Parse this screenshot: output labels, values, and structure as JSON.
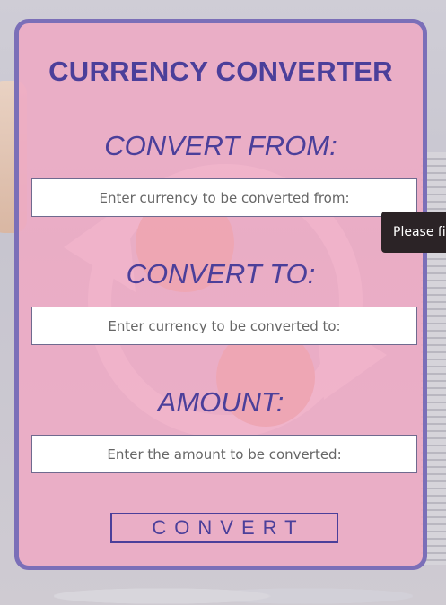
{
  "title": "CURRENCY CONVERTER",
  "from": {
    "label": "CONVERT FROM:",
    "placeholder": "Enter currency to be converted from:",
    "value": ""
  },
  "to": {
    "label": "CONVERT TO:",
    "placeholder": "Enter currency to be converted to:",
    "value": ""
  },
  "amount": {
    "label": "AMOUNT:",
    "placeholder": "Enter the amount to be converted:",
    "value": ""
  },
  "convert_button": "CONVERT",
  "tooltip": "Please fill",
  "colors": {
    "accent": "#4b3f9a",
    "card_border": "#7b6fb8",
    "card_bg": "#eeaac4",
    "tooltip_bg": "#2b2326"
  },
  "icons": {
    "watermark": "currency-exchange-icon"
  }
}
